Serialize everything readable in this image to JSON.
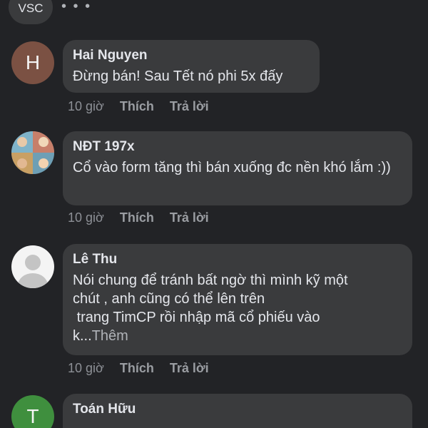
{
  "header": {
    "chip_label": "VSC",
    "more_icon": "more-horizontal-icon"
  },
  "comments": [
    {
      "avatar_letter": "H",
      "avatar_color": "#7b5143",
      "author": "Hai Nguyen",
      "text": "Đừng bán! Sau Tết nó phi 5x đấy",
      "time": "10 giờ",
      "like": "Thích",
      "reply": "Trả lời"
    },
    {
      "avatar_letter": "",
      "author": "NĐT 197x",
      "text": "Cổ vào form tăng thì bán xuống đc nền khó lắm :))",
      "time": "10 giờ",
      "like": "Thích",
      "reply": "Trả lời"
    },
    {
      "avatar_letter": "",
      "author": "Lê Thu",
      "text_lines": [
        "Nói chung để tránh bất ngờ thì mình kỹ một",
        "chút , anh cũng có thể lên trên",
        " trang TimCP rồi nhập mã cổ phiếu vào",
        "k..."
      ],
      "more": "Thêm",
      "time": "10 giờ",
      "like": "Thích",
      "reply": "Trả lời"
    },
    {
      "avatar_letter": "T",
      "avatar_color": "#3f8f3e",
      "author": "Toán Hữu",
      "time": "",
      "like": "",
      "reply": ""
    }
  ]
}
